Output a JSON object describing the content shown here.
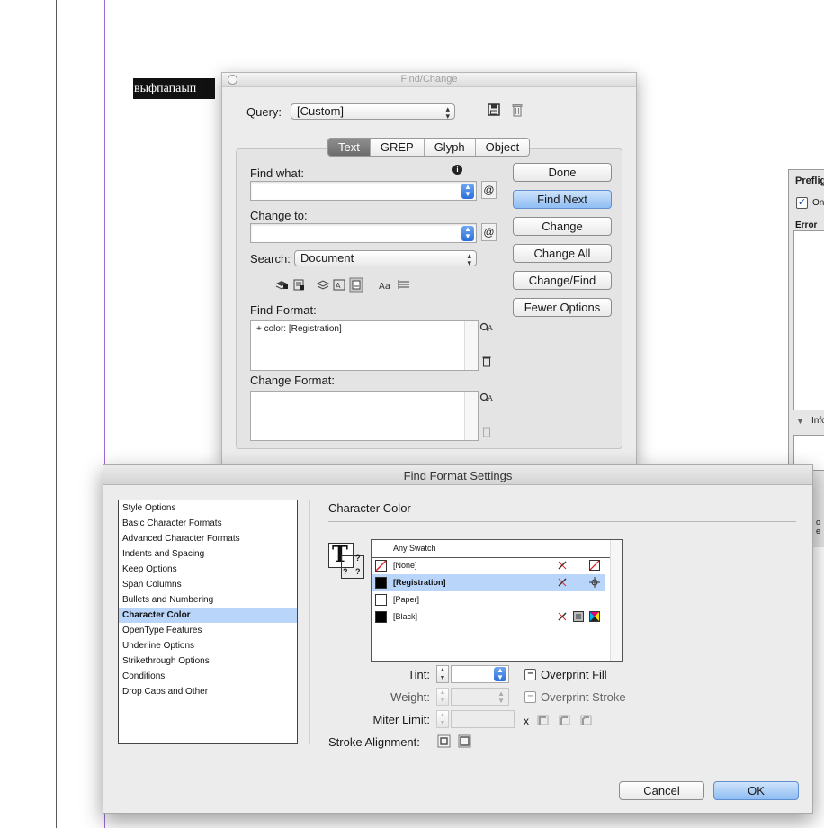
{
  "document": {
    "text": "выфпапаып"
  },
  "find_change": {
    "title": "Find/Change",
    "query_label": "Query:",
    "query_value": "[Custom]",
    "tabs": [
      {
        "label": "Text",
        "active": true
      },
      {
        "label": "GREP",
        "active": false
      },
      {
        "label": "Glyph",
        "active": false
      },
      {
        "label": "Object",
        "active": false
      }
    ],
    "find_what_label": "Find what:",
    "find_what_value": "",
    "change_to_label": "Change to:",
    "change_to_value": "",
    "search_label": "Search:",
    "search_value": "Document",
    "find_format_label": "Find Format:",
    "find_format_value": "+ color: [Registration]",
    "change_format_label": "Change Format:",
    "change_format_value": "",
    "special_char_symbol": "@",
    "buttons": {
      "done": "Done",
      "find_next": "Find Next",
      "change": "Change",
      "change_all": "Change All",
      "change_find": "Change/Find",
      "fewer_options": "Fewer Options"
    }
  },
  "find_format_settings": {
    "title": "Find Format Settings",
    "categories": [
      "Style Options",
      "Basic Character Formats",
      "Advanced Character Formats",
      "Indents and Spacing",
      "Keep Options",
      "Span Columns",
      "Bullets and Numbering",
      "Character Color",
      "OpenType Features",
      "Underline Options",
      "Strikethrough Options",
      "Conditions",
      "Drop Caps and Other"
    ],
    "selected_category": "Character Color",
    "section_title": "Character Color",
    "swatches": [
      {
        "name": "Any Swatch",
        "chip": "",
        "selected": false
      },
      {
        "name": "[None]",
        "chip": "none",
        "selected": false
      },
      {
        "name": "[Registration]",
        "chip": "#000000",
        "selected": true
      },
      {
        "name": "[Paper]",
        "chip": "#ffffff",
        "selected": false
      },
      {
        "name": "[Black]",
        "chip": "#000000",
        "selected": false
      }
    ],
    "tint_label": "Tint:",
    "weight_label": "Weight:",
    "miter_label": "Miter Limit:",
    "miter_x": "x",
    "stroke_alignment_label": "Stroke Alignment:",
    "overprint_fill_label": "Overprint Fill",
    "overprint_stroke_label": "Overprint Stroke",
    "cancel_label": "Cancel",
    "ok_label": "OK"
  },
  "preflight": {
    "title": "Preflig",
    "on_label": "On",
    "error_label": "Error",
    "info_label": "Info",
    "bottom_text": "o e"
  },
  "colors": {
    "selection": "#b9d6fa",
    "default_button": "#8fbdf3",
    "active_tab": "#7a7a7a",
    "margin_guide": "#9b6bd6"
  }
}
